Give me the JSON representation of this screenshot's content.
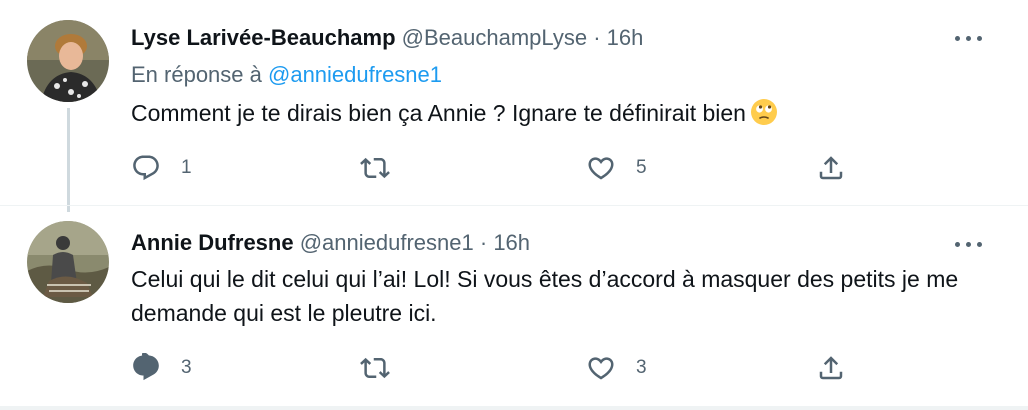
{
  "tweets": [
    {
      "name": "Lyse Larivée-Beauchamp",
      "handle": "@BeauchampLyse",
      "separator": "·",
      "time": "16h",
      "reply_prefix": "En réponse à",
      "reply_mention": "@anniedufresne1",
      "text": "Comment je te dirais bien ça Annie ? Ignare te définirait bien",
      "emoji": "face-with-rolling-eyes-icon",
      "replies": "1",
      "retweets": "",
      "likes": "5"
    },
    {
      "name": "Annie Dufresne",
      "handle": "@anniedufresne1",
      "separator": "·",
      "time": "16h",
      "text": "Celui qui le dit celui qui l’ai! Lol! Si vous êtes d’accord à masquer des petits je me demande qui est le pleutre ici.",
      "replies": "3",
      "retweets": "",
      "likes": "3"
    }
  ],
  "colors": {
    "text_primary": "#0f1419",
    "text_secondary": "#536471",
    "link": "#1d9bf0",
    "border": "#eff3f4",
    "thread_line": "#cfd9de"
  }
}
